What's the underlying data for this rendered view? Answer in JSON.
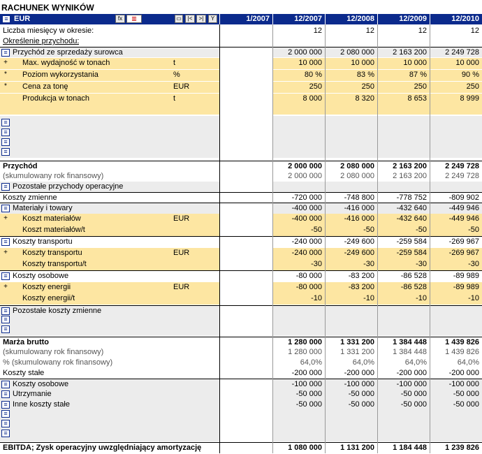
{
  "title": "RACHUNEK WYNIKÓW",
  "header": {
    "currency": "EUR",
    "periods": [
      "1/2007",
      "12/2007",
      "12/2008",
      "12/2009",
      "12/2010"
    ],
    "toolbar": {
      "calc": "fx",
      "chart": "▥",
      "box": "▭",
      "prev": "|<",
      "next": ">|",
      "filter": "Y"
    }
  },
  "rows": [
    {
      "label": "Liczba miesięcy w okresie:",
      "vals": [
        "",
        "12",
        "12",
        "12",
        "12"
      ]
    },
    {
      "label": "Określenie przychodu:",
      "vals": [
        "",
        "",
        "",
        "",
        ""
      ]
    },
    {
      "label": "Przychód ze sprzedaży surowca",
      "vals": [
        "",
        "2 000 000",
        "2 080 000",
        "2 163 200",
        "2 249 728"
      ],
      "icon": "≡"
    },
    {
      "label": "Max. wydajność w tonach",
      "unit": "t",
      "vals": [
        "",
        "10 000",
        "10 000",
        "10 000",
        "10 000"
      ],
      "mark": "+"
    },
    {
      "label": "Poziom wykorzystania",
      "unit": "%",
      "vals": [
        "",
        "80 %",
        "83 %",
        "87 %",
        "90 %"
      ],
      "mark": "*"
    },
    {
      "label": "Cena za tonę",
      "unit": "EUR",
      "vals": [
        "",
        "250",
        "250",
        "250",
        "250"
      ],
      "mark": "*"
    },
    {
      "label": "Produkcja w tonach",
      "unit": "t",
      "vals": [
        "",
        "8 000",
        "8 320",
        "8 653",
        "8 999"
      ]
    },
    {
      "label": "Przychód",
      "vals": [
        "",
        "2 000 000",
        "2 080 000",
        "2 163 200",
        "2 249 728"
      ]
    },
    {
      "label": "(skumulowany rok finansowy)",
      "vals": [
        "",
        "2 000 000",
        "2 080 000",
        "2 163 200",
        "2 249 728"
      ]
    },
    {
      "label": "Pozostałe przychody operacyjne",
      "vals": [
        "",
        "",
        "",
        "",
        ""
      ],
      "icon": "≡"
    },
    {
      "label": "Koszty zmienne",
      "vals": [
        "",
        "-720 000",
        "-748 800",
        "-778 752",
        "-809 902"
      ]
    },
    {
      "label": "Materiały i towary",
      "vals": [
        "",
        "-400 000",
        "-416 000",
        "-432 640",
        "-449 946"
      ],
      "icon": "≡"
    },
    {
      "label": "Koszt materiałów",
      "unit": "EUR",
      "vals": [
        "",
        "-400 000",
        "-416 000",
        "-432 640",
        "-449 946"
      ],
      "mark": "+"
    },
    {
      "label": "Koszt materiałów/t",
      "vals": [
        "",
        "-50",
        "-50",
        "-50",
        "-50"
      ]
    },
    {
      "label": "Koszty transportu",
      "vals": [
        "",
        "-240 000",
        "-249 600",
        "-259 584",
        "-269 967"
      ],
      "icon": "≡"
    },
    {
      "label": "Koszty transportu",
      "unit": "EUR",
      "vals": [
        "",
        "-240 000",
        "-249 600",
        "-259 584",
        "-269 967"
      ],
      "mark": "+"
    },
    {
      "label": "Koszty transportu/t",
      "vals": [
        "",
        "-30",
        "-30",
        "-30",
        "-30"
      ]
    },
    {
      "label": "Koszty osobowe",
      "vals": [
        "",
        "-80 000",
        "-83 200",
        "-86 528",
        "-89 989"
      ],
      "icon": "≡"
    },
    {
      "label": "Koszty energii",
      "unit": "EUR",
      "vals": [
        "",
        "-80 000",
        "-83 200",
        "-86 528",
        "-89 989"
      ],
      "mark": "+"
    },
    {
      "label": "Koszty energii/t",
      "vals": [
        "",
        "-10",
        "-10",
        "-10",
        "-10"
      ]
    },
    {
      "label": "Pozostałe koszty zmienne",
      "vals": [
        "",
        "",
        "",
        "",
        ""
      ],
      "icon": "≡"
    },
    {
      "label": "Marża brutto",
      "vals": [
        "",
        "1 280 000",
        "1 331 200",
        "1 384 448",
        "1 439 826"
      ]
    },
    {
      "label": "(skumulowany rok finansowy)",
      "vals": [
        "",
        "1 280 000",
        "1 331 200",
        "1 384 448",
        "1 439 826"
      ]
    },
    {
      "label": "% (skumulowany rok finansowy)",
      "vals": [
        "",
        "64,0%",
        "64,0%",
        "64,0%",
        "64,0%"
      ]
    },
    {
      "label": "Koszty stałe",
      "vals": [
        "",
        "-200 000",
        "-200 000",
        "-200 000",
        "-200 000"
      ]
    },
    {
      "label": "Koszty osobowe",
      "vals": [
        "",
        "-100 000",
        "-100 000",
        "-100 000",
        "-100 000"
      ],
      "icon": "≡"
    },
    {
      "label": "Utrzymanie",
      "vals": [
        "",
        "-50 000",
        "-50 000",
        "-50 000",
        "-50 000"
      ],
      "icon": "≡"
    },
    {
      "label": "Inne koszty stałe",
      "vals": [
        "",
        "-50 000",
        "-50 000",
        "-50 000",
        "-50 000"
      ],
      "icon": "≡"
    },
    {
      "label": "EBITDA; Zysk operacyjny uwzględniający amortyzację",
      "vals": [
        "",
        "1 080 000",
        "1 131 200",
        "1 184 448",
        "1 239 826"
      ]
    }
  ],
  "empty_icon": "≡"
}
